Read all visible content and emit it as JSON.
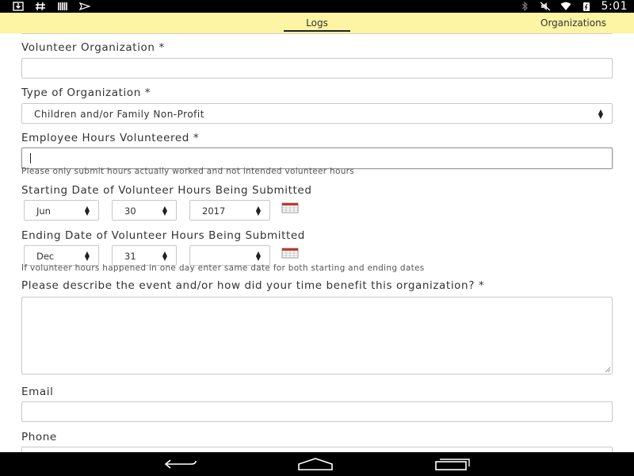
{
  "status_bar": {
    "time": "5:01",
    "left_icons": [
      "download-icon",
      "hash-icon",
      "barcode-icon",
      "send-icon"
    ],
    "right_icons": [
      "bluetooth-icon",
      "mute-icon",
      "wifi-icon",
      "battery-icon"
    ]
  },
  "tabs": [
    {
      "label": "Logs",
      "active": true
    },
    {
      "label": "Organizations",
      "active": false
    }
  ],
  "form": {
    "volunteer_org": {
      "label": "Volunteer Organization *",
      "value": ""
    },
    "org_type": {
      "label": "Type of Organization *",
      "value": "Children and/or Family Non-Profit"
    },
    "hours": {
      "label": "Employee Hours Volunteered *",
      "value": "",
      "help": "Please only submit hours actually worked and not intended volunteer hours"
    },
    "start_date": {
      "label": "Starting Date of Volunteer Hours Being Submitted",
      "month": "Jun",
      "day": "30",
      "year": "2017"
    },
    "end_date": {
      "label": "Ending Date of Volunteer Hours Being Submitted",
      "month": "Dec",
      "day": "31",
      "year": "",
      "help": "If volunteer hours happened in one day enter same date for both starting and ending dates"
    },
    "description": {
      "label": "Please describe the event and/or how did your time benefit this organization? *",
      "value": ""
    },
    "email": {
      "label": "Email",
      "value": ""
    },
    "phone": {
      "label": "Phone",
      "value": ""
    }
  },
  "nav_bar": [
    "back-icon",
    "home-icon",
    "recents-icon"
  ]
}
